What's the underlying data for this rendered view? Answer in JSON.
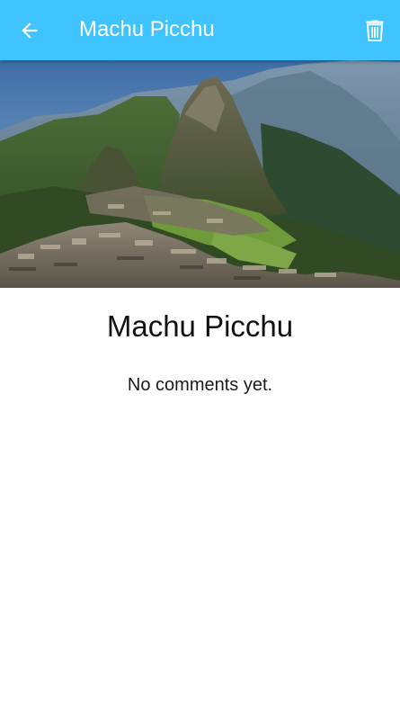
{
  "app_bar": {
    "title": "Machu Picchu",
    "background_color": "#40C4FF",
    "back_icon": "arrow-left-icon",
    "delete_icon": "trash-icon"
  },
  "place": {
    "title": "Machu Picchu",
    "comments_text": "No comments yet."
  }
}
